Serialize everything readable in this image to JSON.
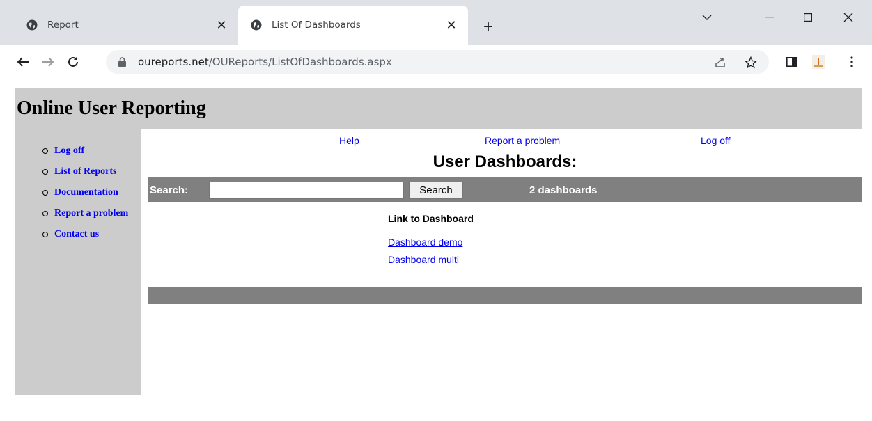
{
  "browser": {
    "tabs": [
      {
        "title": "Report",
        "active": false
      },
      {
        "title": "List Of Dashboards",
        "active": true
      }
    ],
    "url_host": "oureports.net",
    "url_path": "/OUReports/ListOfDashboards.aspx"
  },
  "header": {
    "title": "Online User Reporting"
  },
  "sidebar": {
    "items": [
      {
        "label": "Log off"
      },
      {
        "label": "List of Reports"
      },
      {
        "label": "Documentation"
      },
      {
        "label": "Report a problem"
      },
      {
        "label": "Contact us"
      }
    ]
  },
  "top_links": {
    "help": "Help",
    "report_problem": "Report a problem",
    "logoff": "Log off"
  },
  "main": {
    "title": "User Dashboards:",
    "search": {
      "label": "Search:",
      "value": "",
      "button": "Search",
      "count": "2 dashboards"
    },
    "table": {
      "column_header": "Link to Dashboard",
      "rows": [
        {
          "link": "Dashboard demo"
        },
        {
          "link": "Dashboard multi"
        }
      ]
    }
  },
  "colors": {
    "panel_gray": "#cccccc",
    "bar_gray": "#808080",
    "link_blue": "#0000ee",
    "tabstrip": "#dee1e6"
  }
}
